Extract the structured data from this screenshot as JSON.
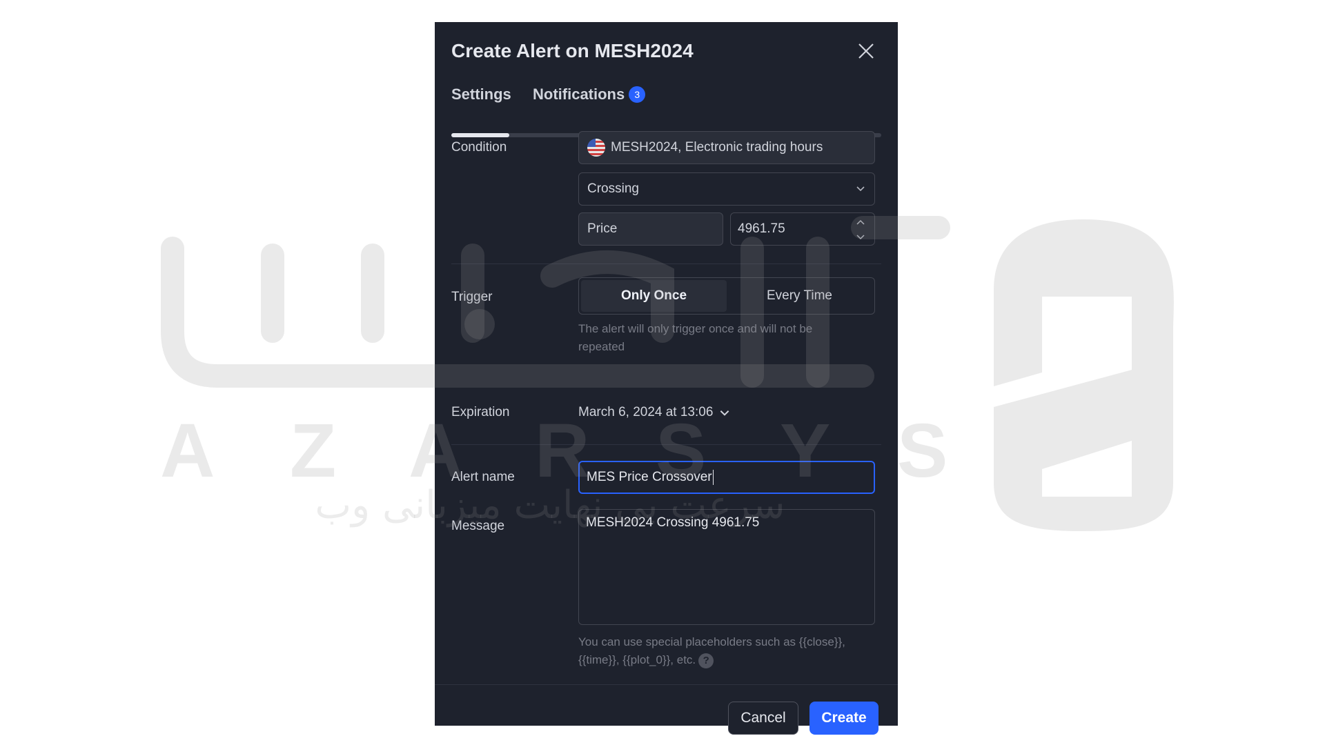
{
  "dialog": {
    "title": "Create Alert on MESH2024",
    "close_icon": "close-icon"
  },
  "tabs": [
    {
      "label": "Settings",
      "active": true
    },
    {
      "label": "Notifications",
      "badge": "3",
      "active": false
    }
  ],
  "condition": {
    "label": "Condition",
    "symbol": "MESH2024, Electronic trading hours",
    "operator": "Crossing",
    "source": "Price",
    "value": "4961.75"
  },
  "trigger": {
    "label": "Trigger",
    "options": [
      "Only Once",
      "Every Time"
    ],
    "selected": "Only Once",
    "hint_line1": "The alert will only trigger once and will not be",
    "hint_line2": "repeated"
  },
  "expiration": {
    "label": "Expiration",
    "value": "March 6, 2024 at 13:06"
  },
  "alert_name": {
    "label": "Alert name",
    "value": "MES Price Crossover"
  },
  "message": {
    "label": "Message",
    "value": "MESH2024 Crossing 4961.75",
    "hint_line1": "You can use special placeholders such as {{close}},",
    "hint_line2": "{{time}}, {{plot_0}}, etc."
  },
  "footer": {
    "cancel_label": "Cancel",
    "create_label": "Create"
  },
  "watermark": {
    "letters": [
      "A",
      "Z",
      "A",
      "R",
      "S",
      "Y",
      "S"
    ],
    "persian": "سرعت بی نهایت میزبانی وب"
  },
  "colors": {
    "dialog_bg": "#1e222d",
    "accent": "#2962ff",
    "badge": "#2962ff"
  }
}
